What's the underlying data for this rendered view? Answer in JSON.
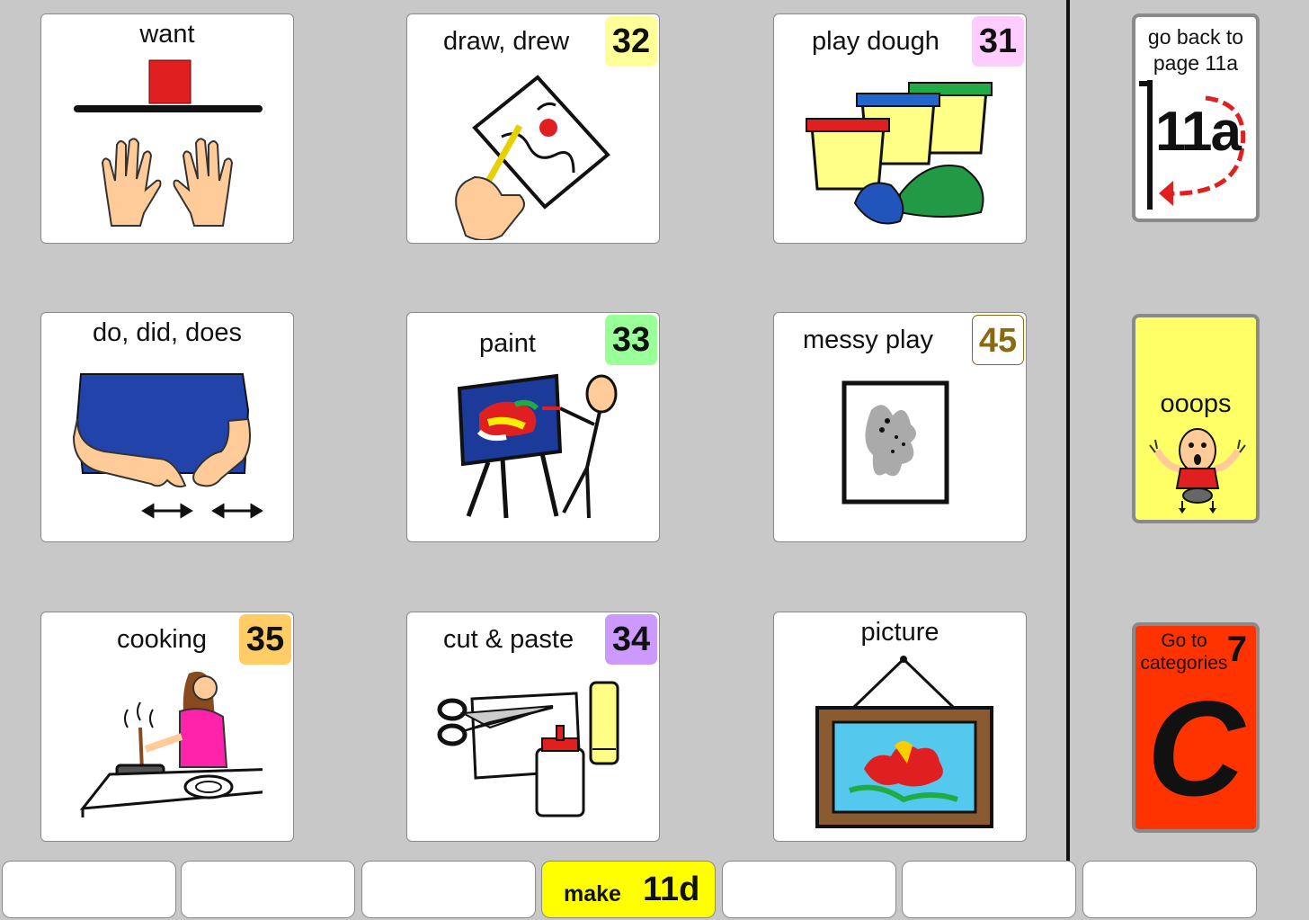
{
  "grid": {
    "cells": [
      {
        "label": "want",
        "badge": null
      },
      {
        "label": "draw,  drew",
        "badge": "32",
        "badge_color": "#ffff99",
        "badge_text": "#111111"
      },
      {
        "label": "play dough",
        "badge": "31",
        "badge_color": "#ffccff",
        "badge_text": "#111111"
      },
      {
        "label": "do,  did,  does",
        "badge": null
      },
      {
        "label": "paint",
        "badge": "33",
        "badge_color": "#99ff99",
        "badge_text": "#111111"
      },
      {
        "label": "messy play",
        "badge": "45",
        "badge_color": "#ffffff",
        "badge_text": "#8a6a10"
      },
      {
        "label": "cooking",
        "badge": "35",
        "badge_color": "#ffcc66",
        "badge_text": "#111111"
      },
      {
        "label": "cut & paste",
        "badge": "34",
        "badge_color": "#cc99ff",
        "badge_text": "#111111"
      },
      {
        "label": "picture",
        "badge": null
      }
    ]
  },
  "sidebar": {
    "back": {
      "label": "go back to page 11a",
      "page": "11a"
    },
    "ooops": {
      "label": "ooops",
      "color": "#ffff66"
    },
    "categories": {
      "label": "Go to categories",
      "number": "7",
      "letter": "C",
      "color": "#ff3300"
    }
  },
  "bottom_bar": {
    "make": {
      "label": "make",
      "page": "11d",
      "color": "#ffff00"
    }
  }
}
